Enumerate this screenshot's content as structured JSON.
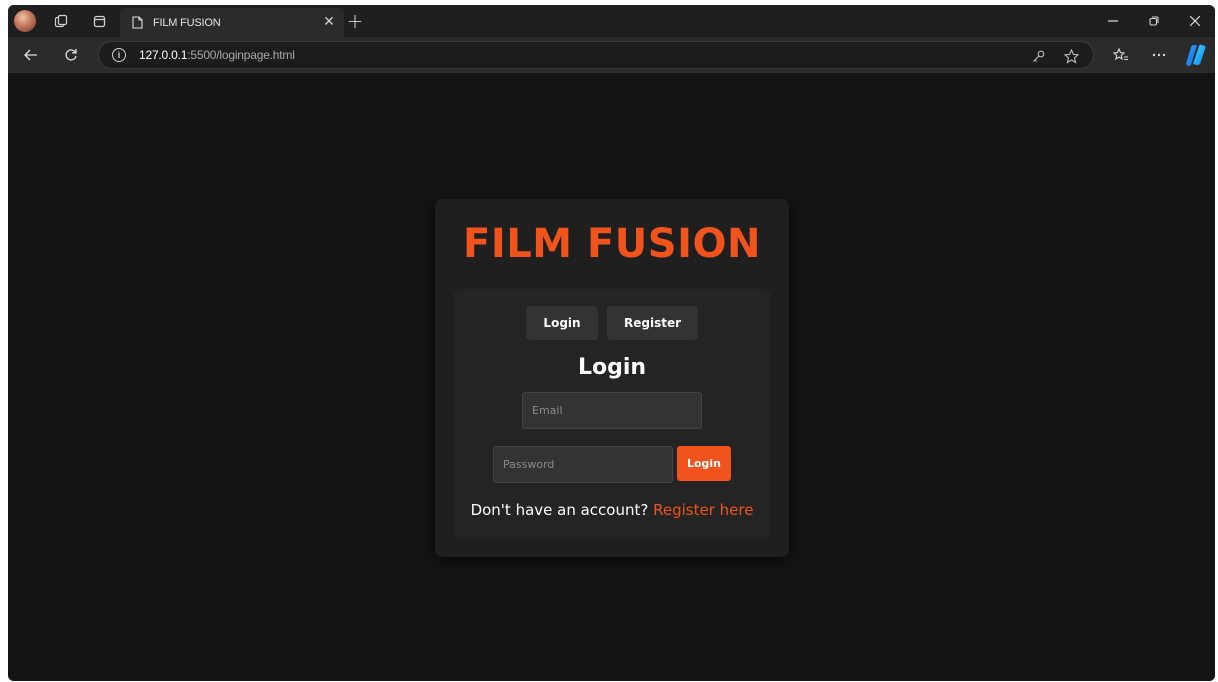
{
  "browser": {
    "tab": {
      "title": "FILM FUSION"
    },
    "address": {
      "host": "127.0.0.1",
      "path": ":5500/loginpage.html"
    }
  },
  "page": {
    "brand": "FILM FUSION",
    "switcher": {
      "login_label": "Login",
      "register_label": "Register"
    },
    "form": {
      "title": "Login",
      "email_placeholder": "Email",
      "password_placeholder": "Password",
      "submit_label": "Login"
    },
    "footer": {
      "prompt": "Don't have an account? ",
      "link": "Register here"
    }
  },
  "colors": {
    "accent": "#f0531c",
    "background": "#141414",
    "card": "#1f1f1f"
  }
}
